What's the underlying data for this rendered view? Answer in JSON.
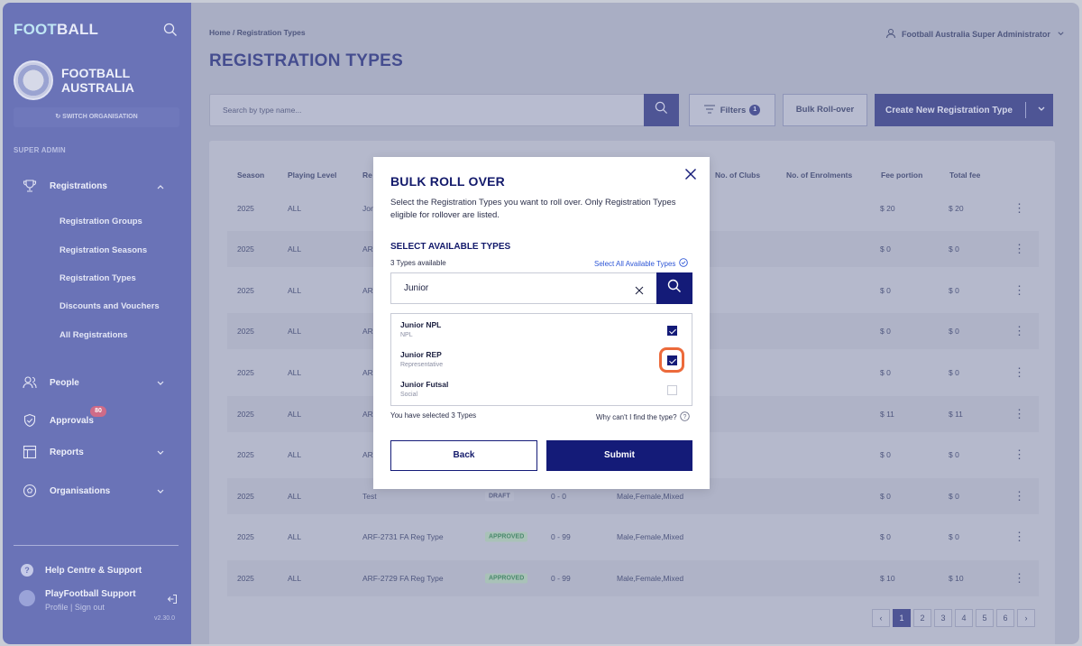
{
  "sidebar": {
    "logo_part1": "FOOT",
    "logo_part2": "BALL",
    "org_name_line1": "FOOTBALL",
    "org_name_line2": "AUSTRALIA",
    "switch_org": "SWITCH ORGANISATION",
    "section_label": "SUPER ADMIN",
    "registrations": "Registrations",
    "sub_items": [
      "Registration Groups",
      "Registration Seasons",
      "Registration Types",
      "Discounts and Vouchers",
      "All Registrations"
    ],
    "people": "People",
    "approvals": "Approvals",
    "approvals_badge": "80",
    "reports": "Reports",
    "organisations": "Organisations",
    "help": "Help Centre & Support",
    "user_name": "PlayFootball Support",
    "user_links": "Profile | Sign out",
    "version": "v2.30.0"
  },
  "header": {
    "breadcrumb": "Home  /  Registration Types",
    "title": "REGISTRATION TYPES",
    "admin": "Football Australia Super Administrator"
  },
  "toolbar": {
    "search_placeholder": "Search by type name...",
    "filters": "Filters",
    "filters_count": "1",
    "bulk": "Bulk Roll-over",
    "create": "Create New Registration Type"
  },
  "table": {
    "headers": {
      "season": "Season",
      "playing_level": "Playing Level",
      "reg": "Re",
      "clubs": "No. of Clubs",
      "enrolments": "No. of Enrolments",
      "fee_portion": "Fee portion",
      "total_fee": "Total fee"
    },
    "rows": [
      {
        "season": "2025",
        "level": "ALL",
        "name": "Jon",
        "status": "",
        "ages": "",
        "gender": "",
        "fee": "$ 20",
        "total": "$ 20"
      },
      {
        "season": "2025",
        "level": "ALL",
        "name": "ARI",
        "status": "",
        "ages": "",
        "gender": "",
        "fee": "$ 0",
        "total": "$ 0"
      },
      {
        "season": "2025",
        "level": "ALL",
        "name": "ARI",
        "status": "",
        "ages": "",
        "gender": "",
        "fee": "$ 0",
        "total": "$ 0"
      },
      {
        "season": "2025",
        "level": "ALL",
        "name": "ARI",
        "status": "",
        "ages": "",
        "gender": "",
        "fee": "$ 0",
        "total": "$ 0"
      },
      {
        "season": "2025",
        "level": "ALL",
        "name": "ARI",
        "status": "",
        "ages": "",
        "gender": "",
        "fee": "$ 0",
        "total": "$ 0"
      },
      {
        "season": "2025",
        "level": "ALL",
        "name": "ARI",
        "status": "",
        "ages": "",
        "gender": "",
        "fee": "$ 11",
        "total": "$ 11"
      },
      {
        "season": "2025",
        "level": "ALL",
        "name": "ARI",
        "status": "",
        "ages": "",
        "gender": "",
        "fee": "$ 0",
        "total": "$ 0"
      },
      {
        "season": "2025",
        "level": "ALL",
        "name": "Test",
        "status": "DRAFT",
        "ages": "0 - 0",
        "gender": "Male,Female,Mixed",
        "fee": "$ 0",
        "total": "$ 0"
      },
      {
        "season": "2025",
        "level": "ALL",
        "name": "ARF-2731 FA Reg Type",
        "status": "APPROVED",
        "ages": "0 - 99",
        "gender": "Male,Female,Mixed",
        "fee": "$ 0",
        "total": "$ 0"
      },
      {
        "season": "2025",
        "level": "ALL",
        "name": "ARF-2729 FA Reg Type",
        "status": "APPROVED",
        "ages": "0 - 99",
        "gender": "Male,Female,Mixed",
        "fee": "$ 10",
        "total": "$ 10"
      }
    ]
  },
  "pagination": {
    "prev": "‹",
    "pages": [
      "1",
      "2",
      "3",
      "4",
      "5",
      "6"
    ],
    "next": "›",
    "current": "1"
  },
  "modal": {
    "title": "BULK ROLL OVER",
    "description": "Select the Registration Types you want to roll over. Only Registration Types eligible for rollover are listed.",
    "section": "SELECT AVAILABLE TYPES",
    "available_count": "3 Types available",
    "select_all": "Select All Available Types",
    "search_value": "Junior",
    "options": [
      {
        "name": "Junior NPL",
        "sub": "NPL",
        "checked": true
      },
      {
        "name": "Junior REP",
        "sub": "Representative",
        "checked": true
      },
      {
        "name": "Junior Futsal",
        "sub": "Social",
        "checked": false
      }
    ],
    "selected_text": "You have selected 3 Types",
    "why_text": "Why can't I find the type?",
    "back": "Back",
    "submit": "Submit"
  },
  "colors": {
    "sidebar": "#6a73b7",
    "primary": "#141b78",
    "highlight_ring": "#ec6a3b",
    "link": "#2e56d6"
  }
}
